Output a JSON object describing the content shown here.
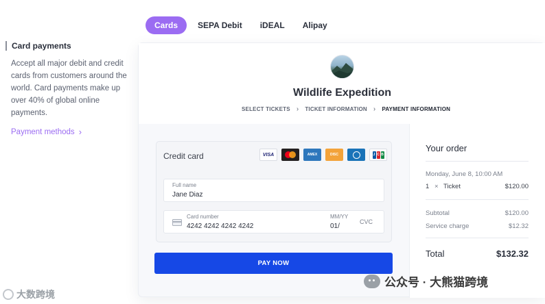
{
  "tabs": [
    {
      "label": "Cards",
      "active": true
    },
    {
      "label": "SEPA Debit",
      "active": false
    },
    {
      "label": "iDEAL",
      "active": false
    },
    {
      "label": "Alipay",
      "active": false
    }
  ],
  "sidebar": {
    "title": "Card payments",
    "description": "Accept all major debit and credit cards from customers around the world. Card payments make up over 40% of global online payments.",
    "link_label": "Payment methods"
  },
  "checkout": {
    "event_title": "Wildlife Expedition",
    "steps": [
      "SELECT TICKETS",
      "TICKET INFORMATION",
      "PAYMENT INFORMATION"
    ],
    "current_step": "PAYMENT INFORMATION",
    "credit_card_label": "Credit card",
    "brands": [
      "VISA",
      "Mastercard",
      "American Express",
      "Discover",
      "Diners Club",
      "JCB"
    ],
    "full_name_label": "Full name",
    "full_name_value": "Jane Diaz",
    "card_number_label": "Card number",
    "card_number_value": "4242 4242 4242 4242",
    "expiry_label": "MM/YY",
    "expiry_value": "01/",
    "cvc_placeholder": "CVC",
    "pay_button": "PAY NOW"
  },
  "order": {
    "title": "Your order",
    "date": "Monday, June 8, 10:00 AM",
    "item_qty": "1",
    "item_x": "×",
    "item_name": "Ticket",
    "item_price": "$120.00",
    "subtotal_label": "Subtotal",
    "subtotal_value": "$120.00",
    "service_label": "Service charge",
    "service_value": "$12.32",
    "total_label": "Total",
    "total_value": "$132.32"
  },
  "watermarks": {
    "right": "公众号 · 大熊猫跨境",
    "left": "大数跨境"
  },
  "colors": {
    "accent": "#9b6cf2",
    "pay_button": "#1648e6"
  }
}
